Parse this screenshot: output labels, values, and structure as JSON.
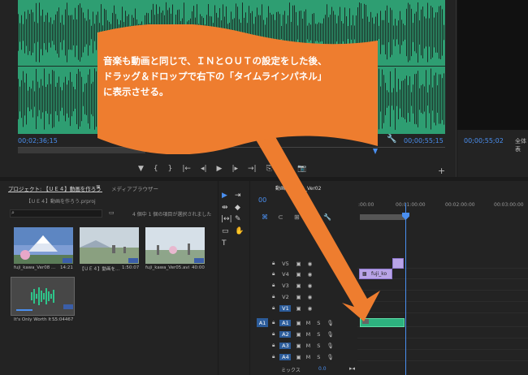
{
  "source_monitor": {
    "timecode_left": "00;02;36;15",
    "timecode_right": "00;00;55;15",
    "controls": [
      "▼",
      "{",
      "}",
      "|←",
      "◂|",
      "▶",
      "|▸",
      "→|",
      "⎘",
      "⎗",
      "📷"
    ]
  },
  "program_monitor": {
    "timecode": "00;00;55;02",
    "fit_label": "全体表"
  },
  "project": {
    "tab_label": "プロジェクト: 【ＵＥ４】動画を作ろう",
    "tab_menu": "≡",
    "media_browser_label": "メディアブラウザー",
    "file_name": "【ＵＥ４】動画を作ろう.prproj",
    "item_count": "4 個中 1 個の項目が選択されました",
    "items": [
      {
        "name": "fuji_kawa_Ver08 ...",
        "duration": "14:21"
      },
      {
        "name": "【ＵＥ４】動画を...",
        "duration": "1:50:07"
      },
      {
        "name": "fuji_kawa_Ver05.avi",
        "duration": "40:00"
      },
      {
        "name": "It's Only Worth It ...",
        "duration": "55:04467"
      }
    ]
  },
  "timeline": {
    "tab_label": "動画を作ろう_Ver02",
    "timecode": "00",
    "ticks": [
      ":00:00",
      "00:01:00:00",
      "00:02:00:00",
      "00:03:00:00"
    ],
    "video_tracks": [
      "V5",
      "V4",
      "V3",
      "V2",
      "V1"
    ],
    "audio_tracks": [
      "A1",
      "A2",
      "A3",
      "A4"
    ],
    "source_patch_audio": "A1",
    "mute_label": "M",
    "solo_label": "S",
    "clip_label": "fuji_ko",
    "mix_label": "ミックス",
    "mix_value": "0.0"
  },
  "annotation": {
    "text": "音楽も動画と同じで、ＩＮとＯＵＴの設定をした後、\nドラッグ＆ドロップで右下の「タイムラインパネル」\nに表示させる。",
    "color": "#ee7d2f"
  }
}
